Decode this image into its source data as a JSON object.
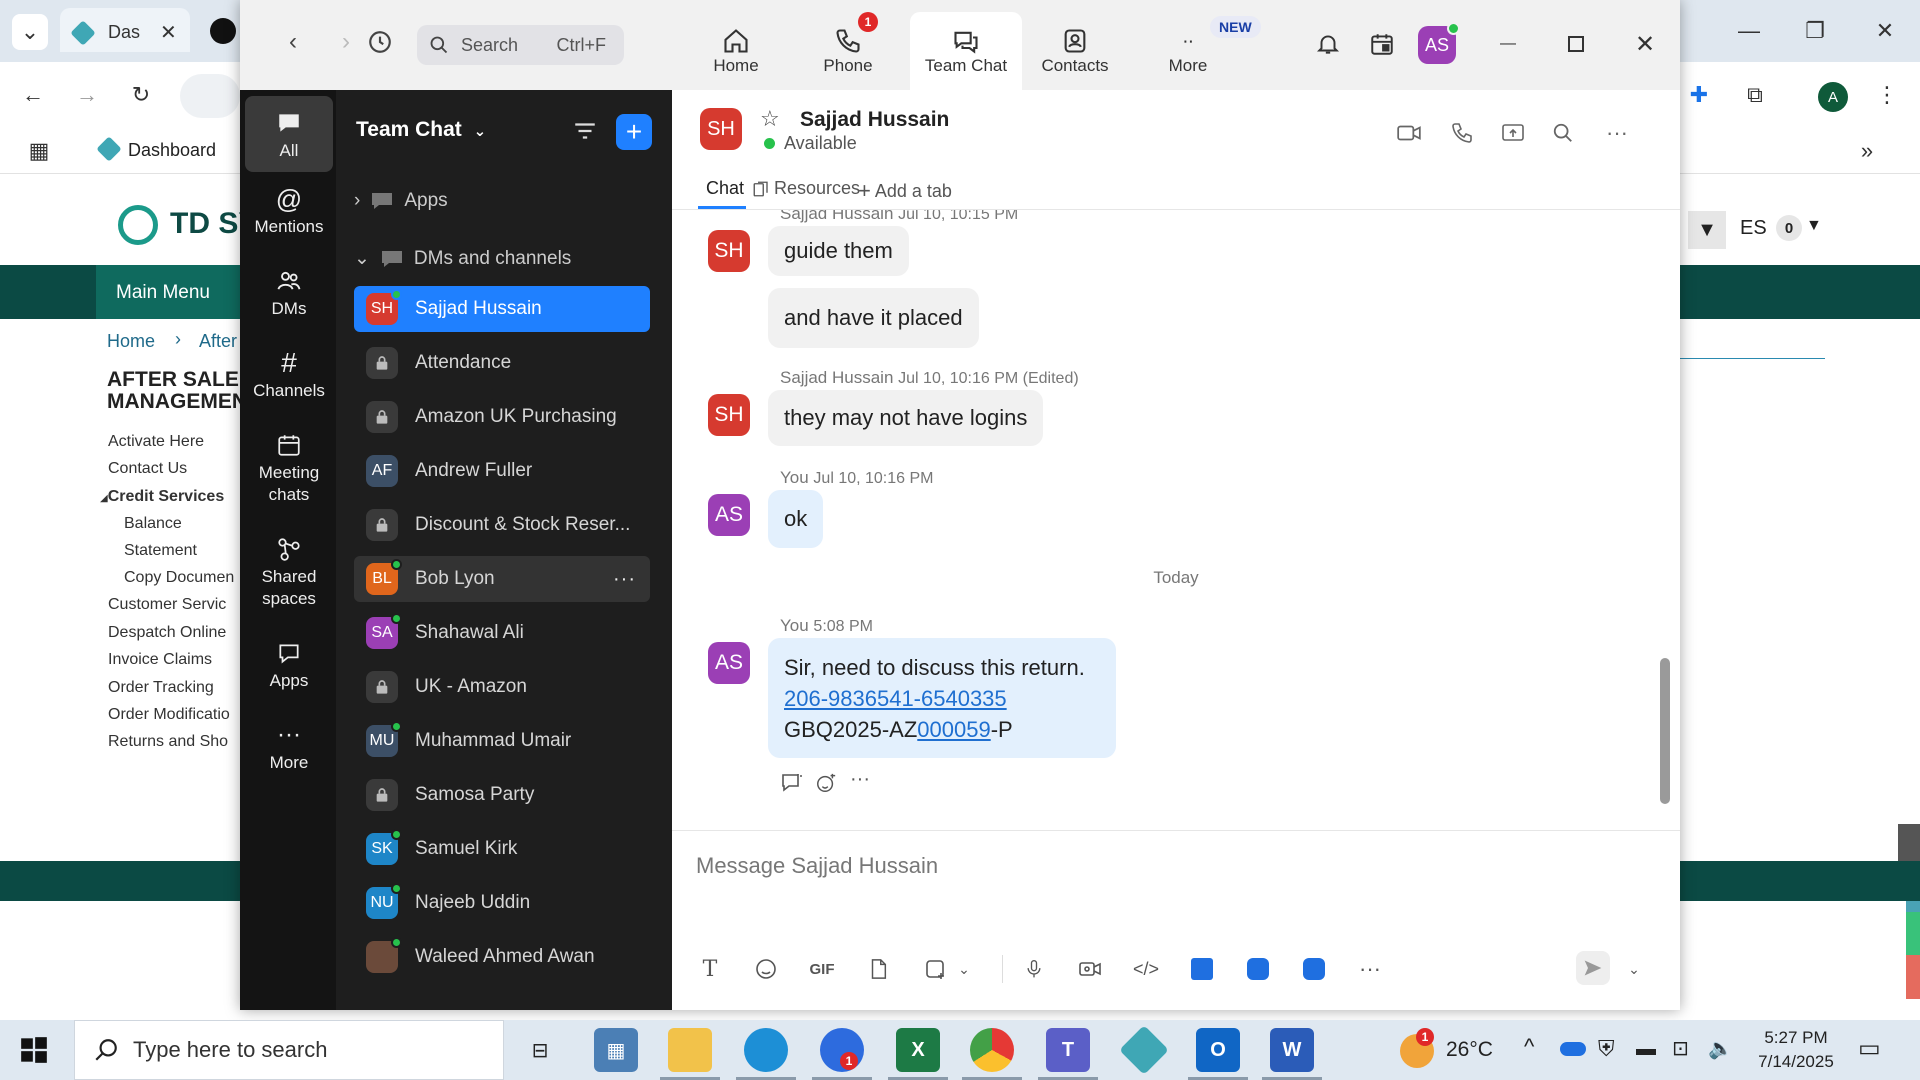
{
  "browser": {
    "tab_title": "Das",
    "bookmark_dashboard": "Dashboard",
    "profile_initial": "A"
  },
  "site": {
    "logo_text": "TD SY",
    "language": "ES",
    "cart_count": "0",
    "main_menu": "Main Menu",
    "breadcrumb_home": "Home",
    "breadcrumb_next": "After",
    "section_title_line1": "AFTER SALE",
    "section_title_line2": "MANAGEMEN",
    "links": [
      "Activate Here",
      "Contact Us",
      "Credit Services",
      "Balance",
      "Statement",
      "Copy Documen",
      "Customer Servic",
      "Despatch Online",
      "Invoice Claims",
      "Order Tracking",
      "Order Modificatio",
      "Returns and Sho"
    ]
  },
  "zoom": {
    "search_placeholder": "Search",
    "search_shortcut": "Ctrl+F",
    "tabs": [
      {
        "label": "Home",
        "icon": "home-icon"
      },
      {
        "label": "Phone",
        "icon": "phone-icon",
        "badge": "1"
      },
      {
        "label": "Team Chat",
        "icon": "chat-icon"
      },
      {
        "label": "Contacts",
        "icon": "contacts-icon"
      },
      {
        "label": "More",
        "icon": "more-icon",
        "badge": "NEW"
      }
    ],
    "user_initials": "AS",
    "rail": [
      {
        "label": "All",
        "icon": "all-chat-icon"
      },
      {
        "label": "Mentions",
        "icon": "at-icon"
      },
      {
        "label": "DMs",
        "icon": "people-icon"
      },
      {
        "label": "Channels",
        "icon": "hash-icon"
      },
      {
        "label": "Meeting chats",
        "icon": "calendar-icon"
      },
      {
        "label": "Shared spaces",
        "icon": "share-icon"
      },
      {
        "label": "Apps",
        "icon": "apps-chat-icon"
      },
      {
        "label": "More",
        "icon": "ellipsis-icon"
      }
    ],
    "list_title": "Team Chat",
    "section_apps": "Apps",
    "section_dms": "DMs and channels",
    "channels": [
      {
        "name": "Sajjad Hussain",
        "initials": "SH",
        "color": "#d63a2f",
        "online": true,
        "selected": true
      },
      {
        "name": "Attendance",
        "lock": true
      },
      {
        "name": "Amazon UK Purchasing",
        "lock": true
      },
      {
        "name": "Andrew Fuller",
        "initials": "AF",
        "color": "#3c4f66",
        "away": true
      },
      {
        "name": "Discount & Stock Reser...",
        "lock": true
      },
      {
        "name": "Bob Lyon",
        "initials": "BL",
        "color": "#e0661c",
        "online": true,
        "hover": true
      },
      {
        "name": "Shahawal Ali",
        "initials": "SA",
        "color": "#9b3fb5",
        "online": true
      },
      {
        "name": "UK - Amazon",
        "lock": true
      },
      {
        "name": "Muhammad Umair",
        "initials": "MU",
        "color": "#3c4f66",
        "online": true
      },
      {
        "name": "Samosa Party",
        "lock": true
      },
      {
        "name": "Samuel Kirk",
        "initials": "SK",
        "color": "#1e86c8",
        "online": true
      },
      {
        "name": "Najeeb Uddin",
        "initials": "NU",
        "color": "#1e86c8",
        "online": true
      },
      {
        "name": "Waleed Ahmed Awan",
        "initials": "",
        "color": "#6b4a3a",
        "online": true
      }
    ],
    "chat": {
      "contact_name": "Sajjad Hussain",
      "contact_initials": "SH",
      "status": "Available",
      "tab_chat": "Chat",
      "tab_resources": "Resources",
      "tab_add": "Add a tab",
      "messages": [
        {
          "sender": "Sajjad Hussain",
          "time": "Jul 10, 10:15 PM",
          "texts": [
            "guide them",
            "and have it placed"
          ],
          "initials": "SH"
        },
        {
          "sender": "Sajjad Hussain",
          "time": "Jul 10, 10:16 PM (Edited)",
          "texts": [
            "they may not have logins"
          ],
          "initials": "SH"
        },
        {
          "sender": "You",
          "time": "Jul 10, 10:16 PM",
          "texts": [
            "ok"
          ],
          "initials": "AS"
        }
      ],
      "divider": "Today",
      "last_message": {
        "sender": "You",
        "time": "5:08 PM",
        "initials": "AS",
        "line1": "Sir, need to discuss this return.",
        "link": "206-9836541-6540335",
        "line3_prefix": "GBQ2025-AZ",
        "line3_link": "000059",
        "line3_suffix": "-P"
      },
      "composer_placeholder": "Message Sajjad Hussain",
      "gif_label": "GIF"
    }
  },
  "taskbar": {
    "search_placeholder": "Type here to search",
    "weather": "26°C",
    "time": "5:27 PM",
    "date": "7/14/2025",
    "zoom_badge": "1",
    "weather_badge": "1"
  },
  "colors": {
    "accent": "#1f80ff",
    "online": "#27c24c",
    "avatar_as": "#9b3fb5"
  }
}
